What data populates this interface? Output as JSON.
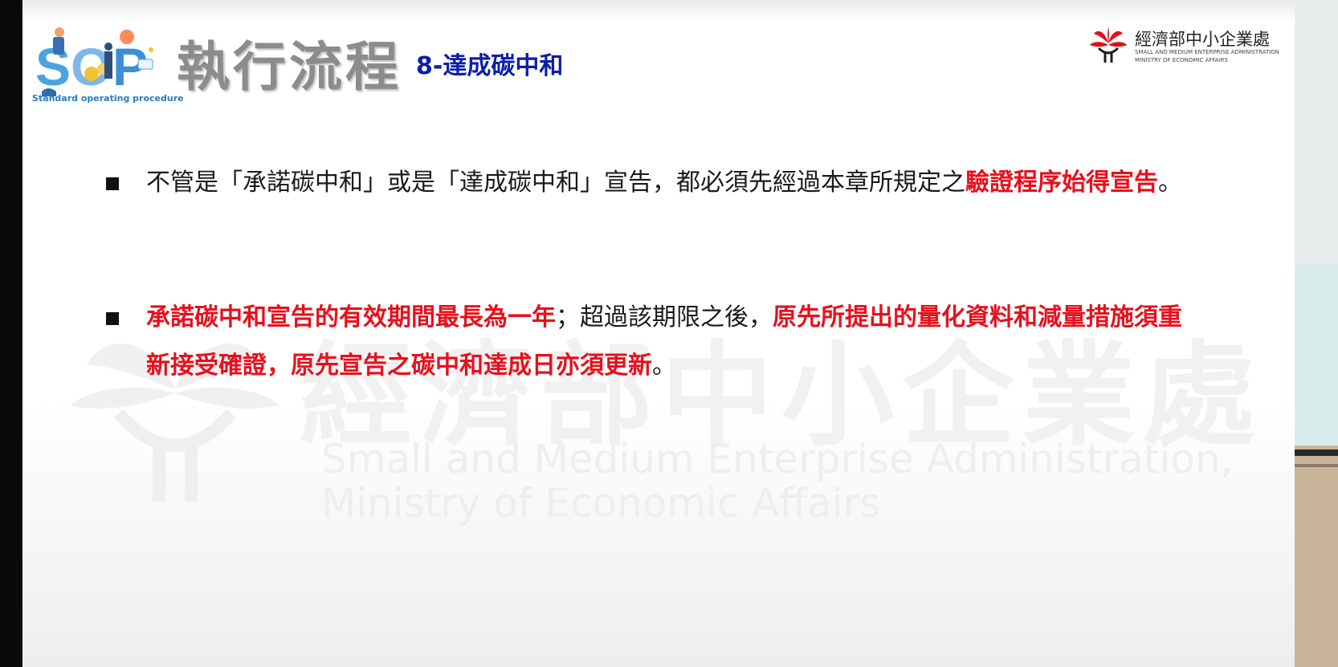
{
  "header": {
    "logo_caption": "Standard operating procedure",
    "title": "執行流程",
    "subtitle": "8-達成碳中和",
    "org_name_cn": "經濟部中小企業處",
    "org_name_en_1": "SMALL AND MEDIUM ENTERPRISE ADMINISTRATION",
    "org_name_en_2": "MINISTRY OF ECONOMIC AFFAIRS"
  },
  "watermark": {
    "cn": "經濟部中小企業處",
    "en_line1": "Small and Medium Enterprise Administration,",
    "en_line2": "Ministry of Economic Affairs"
  },
  "bullets": [
    {
      "part1": "不管是「承諾碳中和」或是「達成碳中和」宣告，都必須先經過本章所規定之",
      "part2_red": "驗證程序始得宣告",
      "part3": "。"
    },
    {
      "part1_red": "承諾碳中和宣告的有效期間最長為一年",
      "part2": "；超過該期限之後，",
      "part3_red": "原先所提出的量化資料和減量措施須重新接受確證，原先宣告之碳中和達成日亦須更新",
      "part4": "。"
    }
  ],
  "colors": {
    "title_gray": "#8c8c8c",
    "subtitle_blue": "#0b1fa8",
    "emphasis_red": "#e8101c",
    "logo_red": "#e0101c"
  },
  "icons": [
    "sop-logo-icon",
    "sme-administration-logo-icon"
  ]
}
